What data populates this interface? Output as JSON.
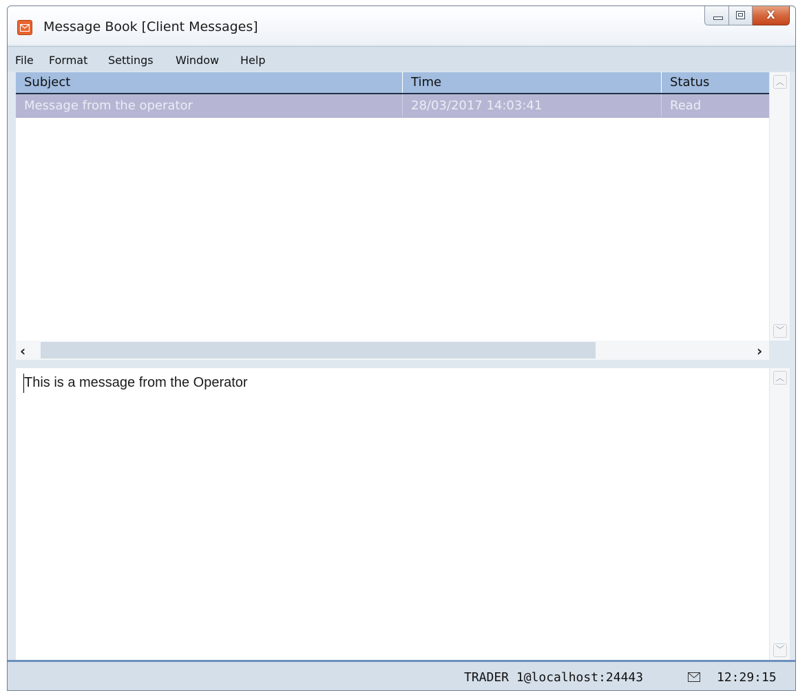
{
  "window": {
    "title": "Message Book [Client Messages]",
    "close_glyph": "X"
  },
  "menu": [
    "File",
    "Format",
    "Settings",
    "Window",
    "Help"
  ],
  "table": {
    "columns": [
      "Subject",
      "Time",
      "Status"
    ],
    "rows": [
      {
        "subject": "Message from the operator",
        "time": "28/03/2017 14:03:41",
        "status": "Read",
        "selected": true
      }
    ]
  },
  "message": {
    "body": "This is a message from the Operator"
  },
  "status": {
    "connection": "TRADER 1@localhost:24443",
    "icon": "envelope-icon",
    "clock": "12:29:15"
  },
  "colors": {
    "header": "#a2bde0",
    "selected_row": "#b6b6d4",
    "status_border": "#6c8fbd",
    "app_icon": "#e8632f"
  }
}
